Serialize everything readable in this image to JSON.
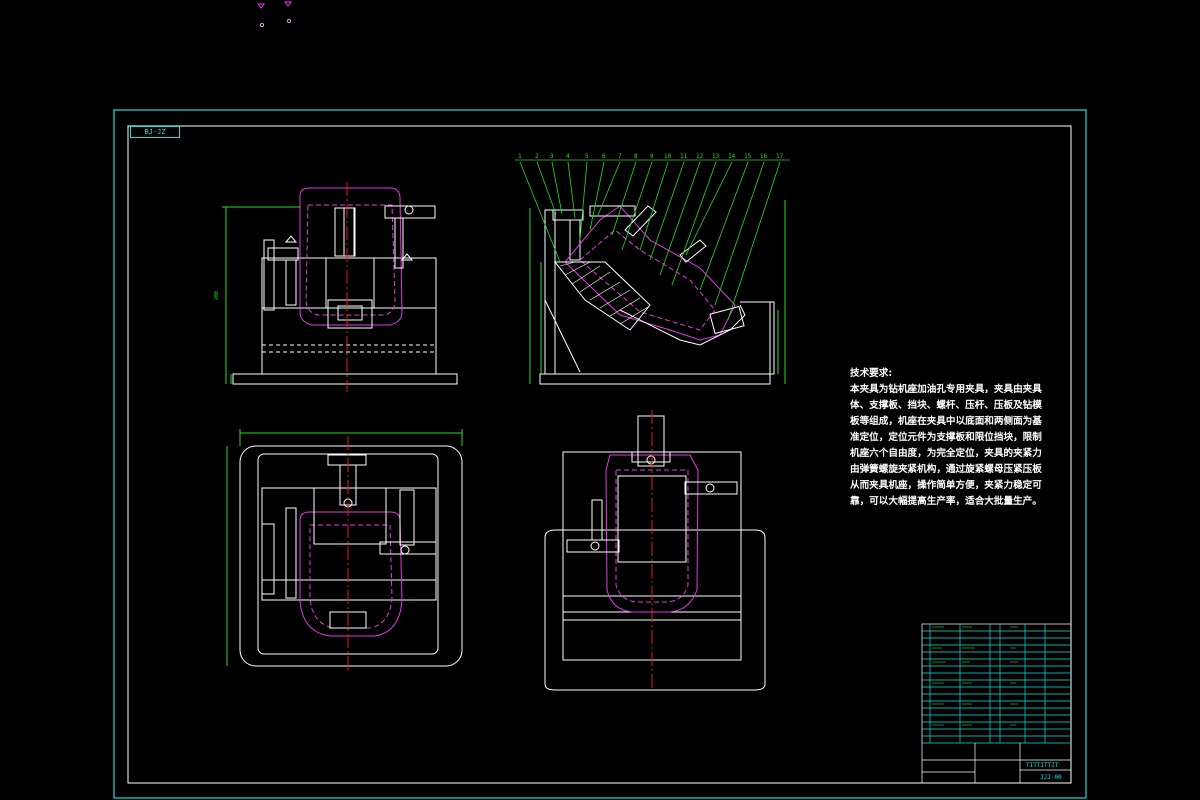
{
  "drawing_number_box": "BJ-JZ",
  "technical_requirements": {
    "title": "技术要求:",
    "body": "本夹具为钻机座加油孔专用夹具，夹具由夹具体、支撑板、挡块、螺杆、压杆、压板及钻模板等组成，机座在夹具中以底面和两侧面为基准定位，定位元件为支撑板和限位挡块，限制机座六个自由度，为完全定位，夹具的夹紧力由弹簧螺旋夹紧机构，通过旋紧螺母压紧压板从而夹具机座，操作简单方便，夹紧力稳定可靠，可以大幅提高生产率，适合大批量生产。"
  },
  "balloon_numbers": [
    "1",
    "2",
    "3",
    "4",
    "5",
    "6",
    "7",
    "8",
    "9",
    "10",
    "11",
    "12",
    "13",
    "14",
    "15",
    "16",
    "17"
  ],
  "title_block": {
    "name": "TITTITTIT",
    "code": "JJJ-00"
  },
  "colors": {
    "border": "#19e0e0",
    "outline": "#ffffff",
    "part": "#e23ae2",
    "center_line": "#e01a1a",
    "dimension": "#22dd22",
    "leader": "#22dd22",
    "background": "#000000"
  }
}
